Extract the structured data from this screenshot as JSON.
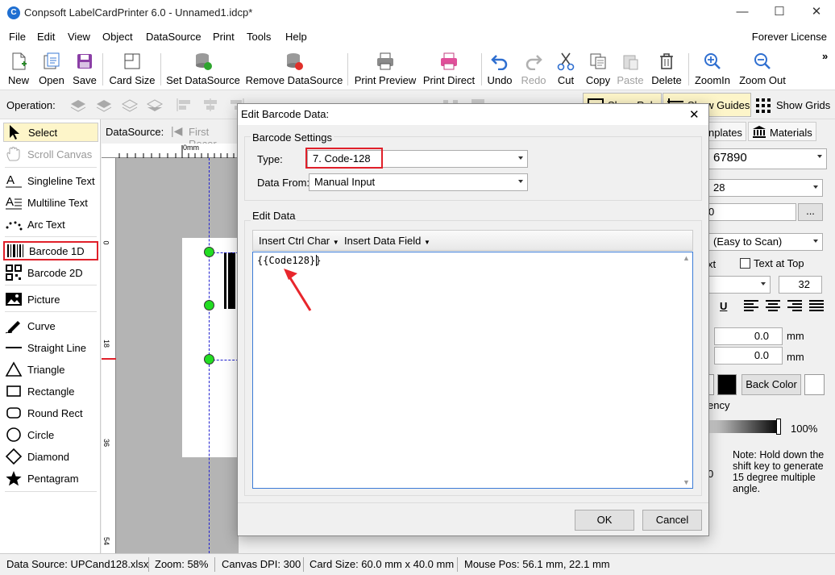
{
  "window": {
    "title": "Conpsoft LabelCardPrinter 6.0 - Unnamed1.idcp*",
    "minimize": "—",
    "maximize": "☐",
    "close": "✕"
  },
  "menu": {
    "items": [
      "File",
      "Edit",
      "View",
      "Object",
      "DataSource",
      "Print",
      "Tools",
      "Help"
    ],
    "license": "Forever License"
  },
  "toolbar": {
    "new": "New",
    "open": "Open",
    "save": "Save",
    "card_size": "Card Size",
    "set_ds": "Set DataSource",
    "remove_ds": "Remove DataSource",
    "print_preview": "Print Preview",
    "print_direct": "Print Direct",
    "undo": "Undo",
    "redo": "Redo",
    "cut": "Cut",
    "copy": "Copy",
    "paste": "Paste",
    "delete": "Delete",
    "zoom_in": "ZoomIn",
    "zoom_out": "Zoom Out",
    "more": "»"
  },
  "opbar": {
    "label": "Operation:",
    "show_rulers": "Show Rulers",
    "show_guides": "Show Guides",
    "show_grids": "Show Grids"
  },
  "tools": {
    "select": "Select",
    "scroll": "Scroll Canvas",
    "singleline": "Singleline Text",
    "multiline": "Multiline Text",
    "arc": "Arc Text",
    "barcode1d": "Barcode 1D",
    "barcode2d": "Barcode 2D",
    "picture": "Picture",
    "curve": "Curve",
    "line": "Straight Line",
    "triangle": "Triangle",
    "rect": "Rectangle",
    "roundrect": "Round Rect",
    "circle": "Circle",
    "diamond": "Diamond",
    "pentagram": "Pentagram"
  },
  "datasource": {
    "label": "DataSource:",
    "first": "First Recor"
  },
  "ruler": {
    "h0": "0mm",
    "v0": "0",
    "v18": "18",
    "v36": "36",
    "v54": "54"
  },
  "right": {
    "tab_templates": "nplates",
    "tab_materials": "Materials",
    "field1": "67890",
    "field2": "28",
    "field3": "0",
    "ellipsis": "...",
    "scan": "(Easy to Scan)",
    "text_partial": "xt",
    "text_top": "Text at Top",
    "size": "32",
    "underline": "U",
    "x": "0.0",
    "y": "0.0",
    "mm": "mm",
    "back_color": "Back Color",
    "transp": "ency",
    "pct": "100%",
    "zero": "0",
    "note": "Note: Hold down the shift key to generate 15 degree multiple angle."
  },
  "dialog": {
    "title": "Edit Barcode Data:",
    "close": "✕",
    "group1": "Barcode Settings",
    "type_label": "Type:",
    "type_value": "7.  Code-128",
    "from_label": "Data From:",
    "from_value": "Manual Input",
    "group2": "Edit Data",
    "insert_ctrl": "Insert Ctrl Char",
    "insert_field": "Insert Data Field",
    "content": "{{Code128}}",
    "ok": "OK",
    "cancel": "Cancel"
  },
  "status": {
    "ds": "Data Source: UPCand128.xlsx",
    "zoom": "Zoom: 58%",
    "dpi": "Canvas DPI: 300",
    "card": "Card Size: 60.0 mm x 40.0 mm",
    "mouse": "Mouse Pos: 56.1 mm, 22.1 mm"
  },
  "colors": {
    "accent_red": "#e0202a",
    "handle_green": "#22dd22",
    "select_bg": "#fdf5c9"
  }
}
